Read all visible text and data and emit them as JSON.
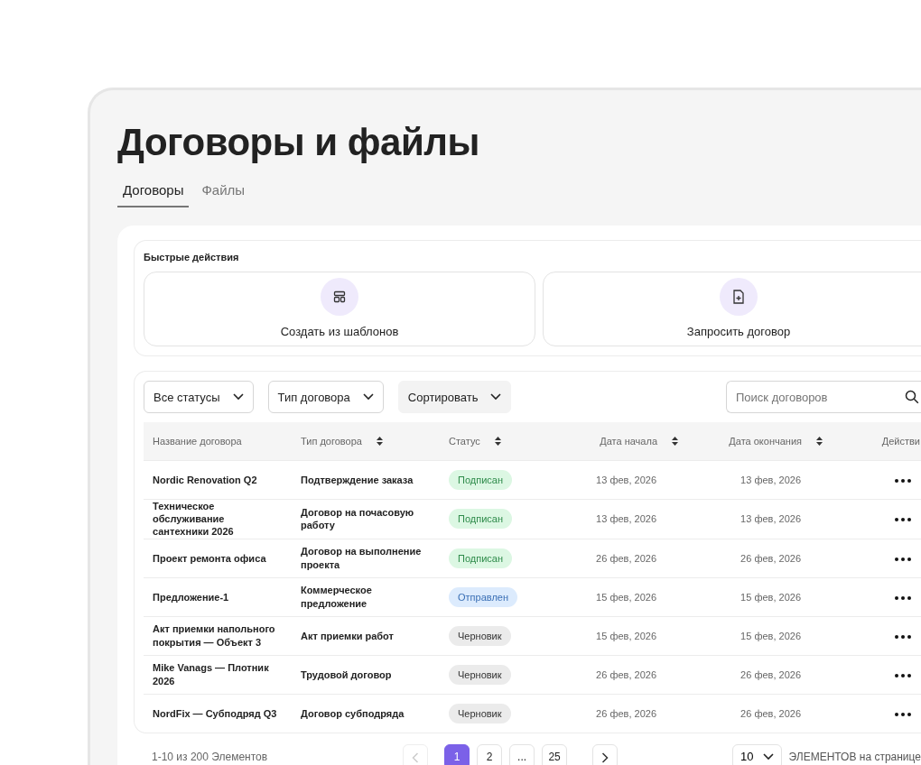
{
  "page": {
    "title": "Договоры и файлы"
  },
  "tabs": [
    {
      "label": "Договоры",
      "selected": true
    },
    {
      "label": "Файлы",
      "selected": false
    }
  ],
  "quick_actions": {
    "title": "Быстрые действия",
    "items": [
      {
        "kind": "template",
        "label": "Создать из шаблонов"
      },
      {
        "kind": "request",
        "label": "Запросить договор"
      }
    ]
  },
  "filters": [
    {
      "label": "Все статусы",
      "kind": "outline"
    },
    {
      "label": "Тип договора",
      "kind": "outline"
    },
    {
      "label": "Сортировать",
      "kind": "filled"
    }
  ],
  "search": {
    "placeholder": "Поиск договоров"
  },
  "table": {
    "columns": [
      {
        "label": "Название договора",
        "sortable": false
      },
      {
        "label": "Тип договора",
        "sortable": true
      },
      {
        "label": "Статус",
        "sortable": true
      },
      {
        "label": "Дата начала",
        "sortable": true
      },
      {
        "label": "Дата окончания",
        "sortable": true
      },
      {
        "label": "Действи",
        "sortable": false
      }
    ],
    "rows": [
      {
        "name": "Nordic Renovation Q2",
        "type": "Подтверждение заказа",
        "status": "Подписан",
        "kind": "signed",
        "start": "13 фев, 2026",
        "end": "13 фев, 2026"
      },
      {
        "name": "Техническое обслуживание сантехники 2026",
        "type": "Договор на почасовую работу",
        "status": "Подписан",
        "kind": "signed",
        "start": "13 фев, 2026",
        "end": "13 фев, 2026"
      },
      {
        "name": "Проект ремонта офиса",
        "type": "Договор на выполнение проекта",
        "status": "Подписан",
        "kind": "signed",
        "start": "26 фев, 2026",
        "end": "26 фев, 2026"
      },
      {
        "name": "Предложение-1",
        "type": "Коммерческое предложение",
        "status": "Отправлен",
        "kind": "sent",
        "start": "15 фев, 2026",
        "end": "15 фев, 2026"
      },
      {
        "name": "Акт приемки напольного покрытия — Объект 3",
        "type": "Акт приемки работ",
        "status": "Черновик",
        "kind": "draft",
        "start": "15 фев, 2026",
        "end": "15 фев, 2026"
      },
      {
        "name": "Mike Vanags — Плотник 2026",
        "type": "Трудовой договор",
        "status": "Черновик",
        "kind": "draft",
        "start": "26 фев, 2026",
        "end": "26 фев, 2026"
      },
      {
        "name": "NordFix — Субподряд Q3",
        "type": "Договор субподряда",
        "status": "Черновик",
        "kind": "draft",
        "start": "26 фев, 2026",
        "end": "26 фев, 2026"
      }
    ]
  },
  "pagination": {
    "summary": "1-10 из 200 Элементов",
    "prev_disabled": true,
    "pages": [
      {
        "label": "1",
        "selected": true
      },
      {
        "label": "2",
        "selected": false
      },
      {
        "label": "...",
        "selected": false
      },
      {
        "label": "25",
        "selected": false
      }
    ],
    "per_page": "10",
    "per_page_label": "ЭЛЕМЕНТОВ на странице"
  }
}
